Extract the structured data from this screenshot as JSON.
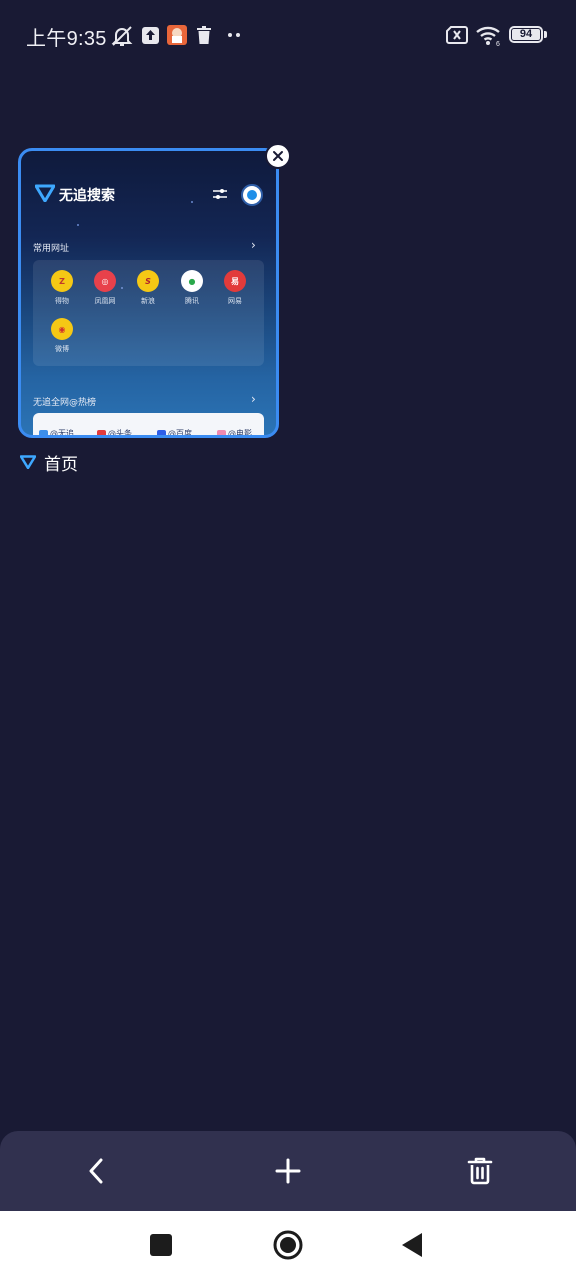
{
  "status_bar": {
    "time": "上午9:35",
    "battery_level": "94",
    "icons": [
      "mute-bell-icon",
      "upload-icon",
      "app-notification-icon",
      "trash-icon",
      "more-dots-icon",
      "no-sim-icon",
      "wifi-icon",
      "battery-icon"
    ]
  },
  "tab": {
    "caption": "首页",
    "preview": {
      "brand": "无追搜索",
      "common_sites_title": "常用网址",
      "sites": [
        {
          "label": "得物",
          "icon": "dewu-icon",
          "color": "#f5c815"
        },
        {
          "label": "凤凰网",
          "icon": "ifeng-icon",
          "color": "#e8414b"
        },
        {
          "label": "新浪",
          "icon": "sina-icon",
          "color": "#f5c815"
        },
        {
          "label": "腾讯",
          "icon": "tencent-icon",
          "color": "#ffffff"
        },
        {
          "label": "网易",
          "icon": "netease-icon",
          "color": "#e23b3b"
        },
        {
          "label": "微博",
          "icon": "weibo-icon",
          "color": "#f5c815"
        }
      ],
      "hot_title": "无追全网@热榜",
      "hot_items": [
        "@无追",
        "@头条",
        "@百度",
        "@电影"
      ]
    }
  },
  "toolbar": {
    "back_icon": "back-arrow-icon",
    "new_tab_icon": "plus-icon",
    "clear_icon": "trash-icon"
  },
  "system_nav": {
    "recents_icon": "square-icon",
    "home_icon": "circle-icon",
    "back_icon": "triangle-back-icon"
  },
  "colors": {
    "background": "#191a34",
    "card_border": "#3b8cf2",
    "toolbar": "#31314f"
  }
}
